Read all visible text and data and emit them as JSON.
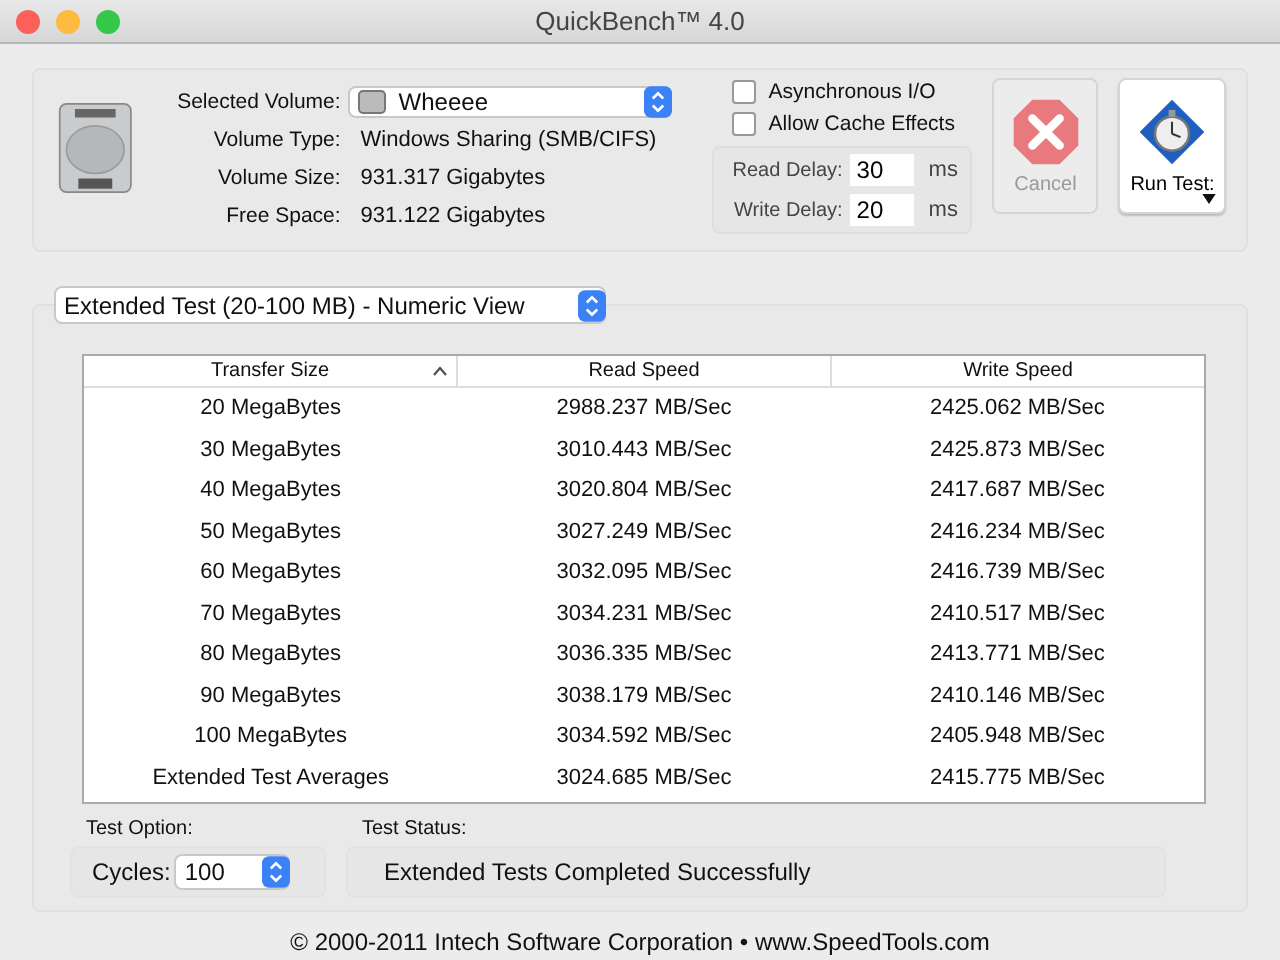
{
  "window": {
    "title": "QuickBench™ 4.0"
  },
  "volume": {
    "label": "Selected Volume:",
    "value": "Wheeee"
  },
  "info": [
    {
      "label": "Volume Type:",
      "value": "Windows Sharing (SMB/CIFS)"
    },
    {
      "label": "Volume Size:",
      "value": "931.317 Gigabytes"
    },
    {
      "label": "Free Space:",
      "value": "931.122 Gigabytes"
    }
  ],
  "options": [
    {
      "label": "Asynchronous I/O",
      "checked": false
    },
    {
      "label": "Allow Cache Effects",
      "checked": false
    }
  ],
  "delays": [
    {
      "label": "Read Delay:",
      "value": "30",
      "unit": "ms"
    },
    {
      "label": "Write Delay:",
      "value": "20",
      "unit": "ms"
    }
  ],
  "cancel_button": {
    "label": "Cancel",
    "disabled": true
  },
  "run_button": {
    "label": "Run Test:"
  },
  "view_select": {
    "value": "Extended Test (20-100 MB) - Numeric View"
  },
  "table": {
    "columns": [
      {
        "label": "Transfer Size",
        "sorted": true
      },
      {
        "label": "Read Speed",
        "sorted": false
      },
      {
        "label": "Write Speed",
        "sorted": false
      }
    ],
    "rows": [
      [
        "20 MegaBytes",
        "2988.237 MB/Sec",
        "2425.062 MB/Sec"
      ],
      [
        "30 MegaBytes",
        "3010.443 MB/Sec",
        "2425.873 MB/Sec"
      ],
      [
        "40 MegaBytes",
        "3020.804 MB/Sec",
        "2417.687 MB/Sec"
      ],
      [
        "50 MegaBytes",
        "3027.249 MB/Sec",
        "2416.234 MB/Sec"
      ],
      [
        "60 MegaBytes",
        "3032.095 MB/Sec",
        "2416.739 MB/Sec"
      ],
      [
        "70 MegaBytes",
        "3034.231 MB/Sec",
        "2410.517 MB/Sec"
      ],
      [
        "80 MegaBytes",
        "3036.335 MB/Sec",
        "2413.771 MB/Sec"
      ],
      [
        "90 MegaBytes",
        "3038.179 MB/Sec",
        "2410.146 MB/Sec"
      ],
      [
        "100 MegaBytes",
        "3034.592 MB/Sec",
        "2405.948 MB/Sec"
      ],
      [
        "Extended Test Averages",
        "3024.685 MB/Sec",
        "2415.775 MB/Sec"
      ]
    ]
  },
  "test_option": {
    "heading": "Test Option:",
    "label": "Cycles:",
    "value": "100"
  },
  "test_status": {
    "heading": "Test Status:",
    "text": "Extended Tests Completed Successfully"
  },
  "footer": "© 2000-2011 Intech Software Corporation • www.SpeedTools.com"
}
